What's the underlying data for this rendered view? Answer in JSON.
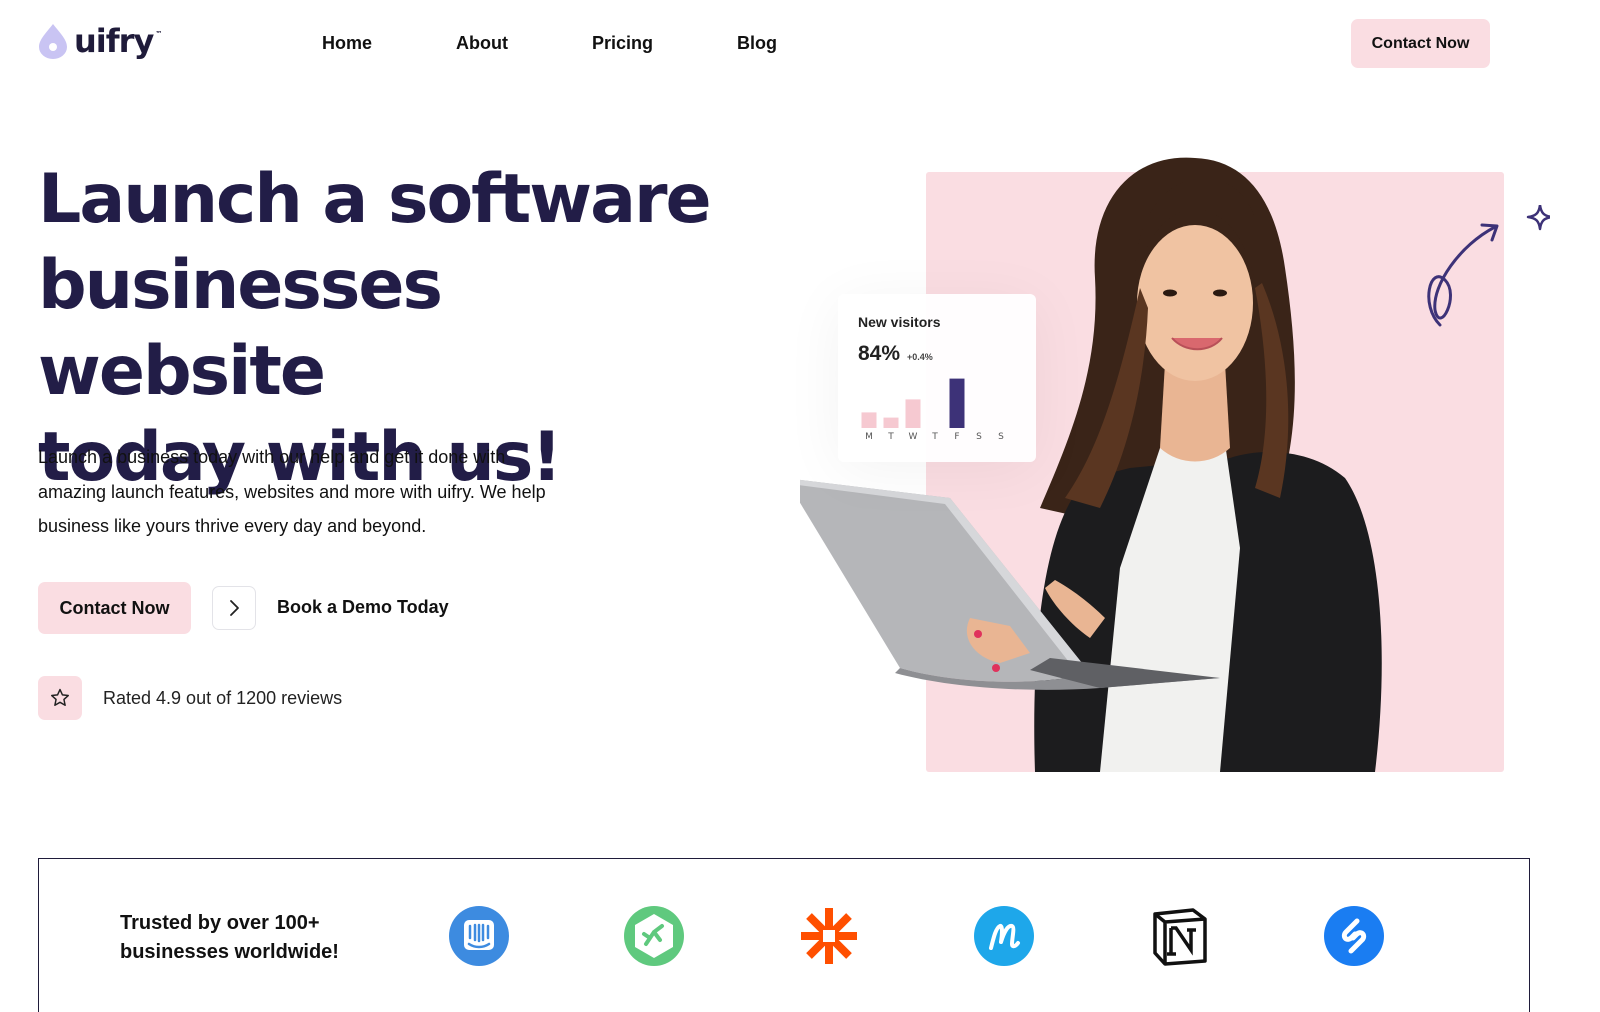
{
  "brand": {
    "name": "uifry",
    "tm": "™"
  },
  "nav": {
    "items": [
      {
        "label": "Home"
      },
      {
        "label": "About"
      },
      {
        "label": "Pricing"
      },
      {
        "label": "Blog"
      }
    ],
    "cta_label": "Contact Now"
  },
  "hero": {
    "title_lines": [
      "Launch a software",
      "businesses website",
      "today with us!"
    ],
    "description_lines": [
      "Launch a business today with our help and get it done with",
      "amazing launch features, websites and more with uifry. We help",
      "business like yours thrive every day and beyond."
    ],
    "primary_cta": "Contact Now",
    "secondary_cta": "Book a Demo Today",
    "rating_text": "Rated 4.9 out of 1200 reviews"
  },
  "stats_card": {
    "label": "New visitors",
    "value": "84%",
    "delta": "+0.4%",
    "days": [
      "M",
      "T",
      "W",
      "T",
      "F",
      "S",
      "S"
    ],
    "values": [
      0.3,
      0.2,
      0.55,
      0,
      0.95,
      0,
      0
    ],
    "highlight_index": 4
  },
  "trusted": {
    "text_lines": [
      "Trusted by over 100+",
      "businesses worldwide!"
    ],
    "logos": [
      {
        "icon": "intercom-icon"
      },
      {
        "icon": "frog-icon"
      },
      {
        "icon": "zapier-icon"
      },
      {
        "icon": "monday-icon"
      },
      {
        "icon": "notion-icon"
      },
      {
        "icon": "shazam-icon"
      }
    ]
  },
  "colors": {
    "accent_pink": "#fadde2",
    "brand_navy": "#221d47",
    "bar_dark": "#3d3278",
    "bar_light": "#f6c9d1"
  }
}
